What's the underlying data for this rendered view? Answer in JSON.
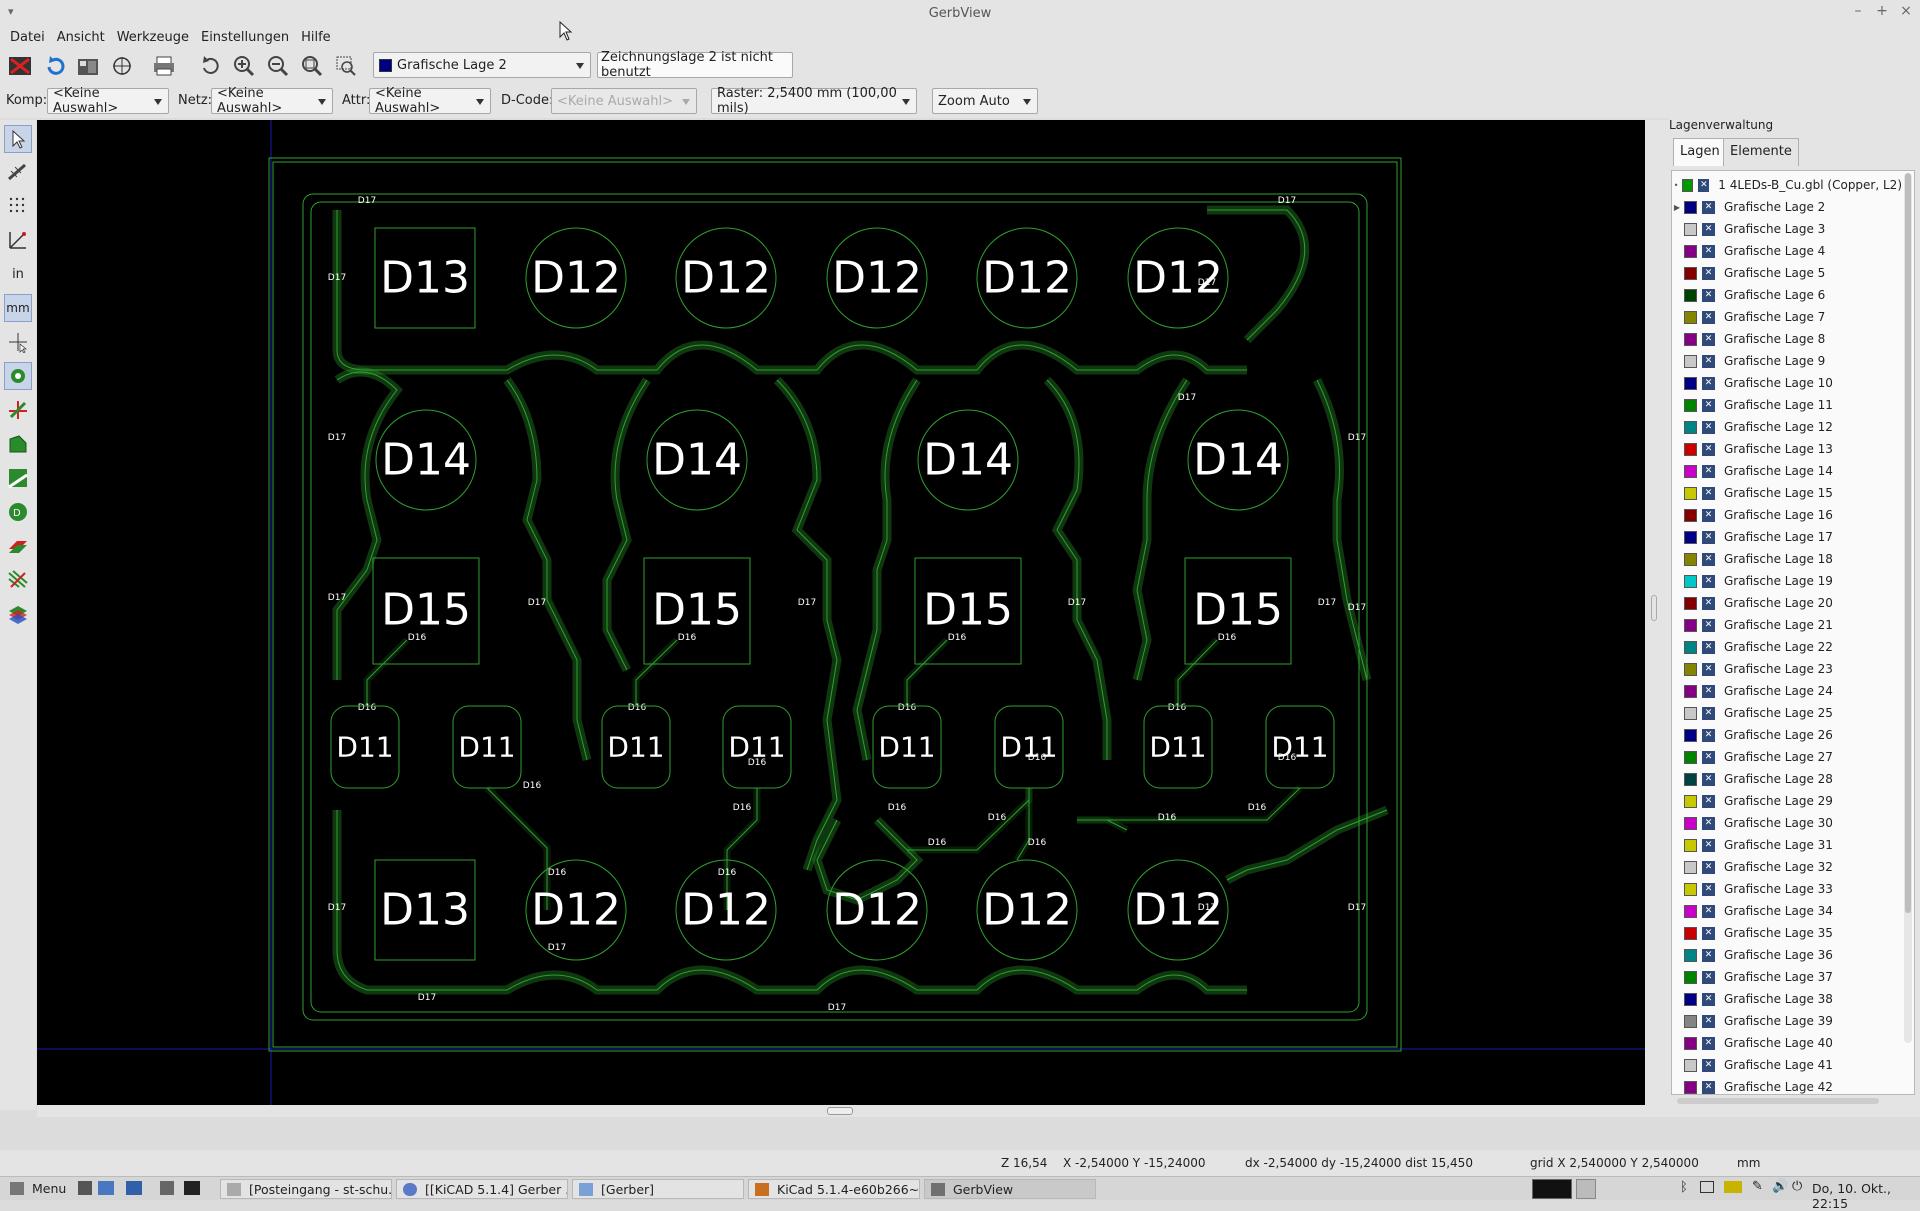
{
  "window": {
    "title": "GerbView"
  },
  "menu": [
    "Datei",
    "Ansicht",
    "Werkzeuge",
    "Einstellungen",
    "Hilfe"
  ],
  "toolbar": {
    "layer_select": {
      "value": "Grafische Lage 2",
      "color": "#000080"
    },
    "dcode_notice": "Zeichnungslage 2 ist nicht benutzt"
  },
  "filterbar": {
    "komp_label": "Komp:",
    "komp_value": "<Keine Auswahl>",
    "netz_label": "Netz:",
    "netz_value": "<Keine Auswahl>",
    "attr_label": "Attr:",
    "attr_value": "<Keine Auswahl>",
    "dcode_label": "D-Code:",
    "dcode_value": "<Keine Auswahl>",
    "grid_value": "Raster: 2,5400 mm (100,00 mils)",
    "zoom_value": "Zoom Auto"
  },
  "left_toolbar": {
    "units_in": "in",
    "units_mm": "mm"
  },
  "canvas": {
    "pad_labels": {
      "top_row": [
        "D13",
        "D12",
        "D12",
        "D12",
        "D12",
        "D12"
      ],
      "row_d14": [
        "D14",
        "D14",
        "D14",
        "D14"
      ],
      "row_d15": [
        "D15",
        "D15",
        "D15",
        "D15"
      ],
      "row_d11": [
        "D11",
        "D11",
        "D11",
        "D11",
        "D11",
        "D11",
        "D11",
        "D11"
      ],
      "bottom_row": [
        "D13",
        "D12",
        "D12",
        "D12",
        "D12",
        "D12"
      ]
    },
    "trace_labels": {
      "d16": "D16",
      "d17": "D17"
    },
    "colors": {
      "background": "#000000",
      "outline": "#2fa12f",
      "axis": "#0000aa"
    }
  },
  "panel": {
    "title": "Lagenverwaltung",
    "tabs": [
      "Lagen",
      "Elemente"
    ],
    "layers": [
      {
        "name": "1 4LEDs-B_Cu.gbl (Copper, L2)",
        "color": "#009900"
      },
      {
        "name": "Grafische Lage 2",
        "color": "#000080"
      },
      {
        "name": "Grafische Lage 3",
        "color": "#c8c8c8"
      },
      {
        "name": "Grafische Lage 4",
        "color": "#840084"
      },
      {
        "name": "Grafische Lage 5",
        "color": "#840000"
      },
      {
        "name": "Grafische Lage 6",
        "color": "#004200"
      },
      {
        "name": "Grafische Lage 7",
        "color": "#848400"
      },
      {
        "name": "Grafische Lage 8",
        "color": "#840084"
      },
      {
        "name": "Grafische Lage 9",
        "color": "#c8c8c8"
      },
      {
        "name": "Grafische Lage 10",
        "color": "#000084"
      },
      {
        "name": "Grafische Lage 11",
        "color": "#008400"
      },
      {
        "name": "Grafische Lage 12",
        "color": "#008484"
      },
      {
        "name": "Grafische Lage 13",
        "color": "#c80000"
      },
      {
        "name": "Grafische Lage 14",
        "color": "#c800c8"
      },
      {
        "name": "Grafische Lage 15",
        "color": "#c8c800"
      },
      {
        "name": "Grafische Lage 16",
        "color": "#840000"
      },
      {
        "name": "Grafische Lage 17",
        "color": "#000084"
      },
      {
        "name": "Grafische Lage 18",
        "color": "#848400"
      },
      {
        "name": "Grafische Lage 19",
        "color": "#00c8c8"
      },
      {
        "name": "Grafische Lage 20",
        "color": "#840000"
      },
      {
        "name": "Grafische Lage 21",
        "color": "#840084"
      },
      {
        "name": "Grafische Lage 22",
        "color": "#008484"
      },
      {
        "name": "Grafische Lage 23",
        "color": "#848400"
      },
      {
        "name": "Grafische Lage 24",
        "color": "#840084"
      },
      {
        "name": "Grafische Lage 25",
        "color": "#c8c8c8"
      },
      {
        "name": "Grafische Lage 26",
        "color": "#000084"
      },
      {
        "name": "Grafische Lage 27",
        "color": "#008400"
      },
      {
        "name": "Grafische Lage 28",
        "color": "#004242"
      },
      {
        "name": "Grafische Lage 29",
        "color": "#c8c800"
      },
      {
        "name": "Grafische Lage 30",
        "color": "#c800c8"
      },
      {
        "name": "Grafische Lage 31",
        "color": "#c8c800"
      },
      {
        "name": "Grafische Lage 32",
        "color": "#c8c8c8"
      },
      {
        "name": "Grafische Lage 33",
        "color": "#c8c800"
      },
      {
        "name": "Grafische Lage 34",
        "color": "#c800c8"
      },
      {
        "name": "Grafische Lage 35",
        "color": "#c80000"
      },
      {
        "name": "Grafische Lage 36",
        "color": "#008484"
      },
      {
        "name": "Grafische Lage 37",
        "color": "#008400"
      },
      {
        "name": "Grafische Lage 38",
        "color": "#000084"
      },
      {
        "name": "Grafische Lage 39",
        "color": "#848484"
      },
      {
        "name": "Grafische Lage 40",
        "color": "#840084"
      },
      {
        "name": "Grafische Lage 41",
        "color": "#c8c8c8"
      },
      {
        "name": "Grafische Lage 42",
        "color": "#840084"
      }
    ]
  },
  "status": {
    "zoom": "Z 16,54",
    "xy": "X -2,54000  Y -15,24000",
    "delta": "dx -2,54000  dy -15,24000  dist 15,450",
    "grid": "grid X 2,540000  Y 2,540000",
    "units": "mm"
  },
  "taskbar": {
    "menu": "Menu",
    "tasks": [
      "[Posteingang - st-schu...",
      "[[KiCAD 5.1.4] Gerber ...",
      "[Gerber]",
      "KiCad 5.1.4-e60b266~...",
      "GerbView"
    ],
    "clock": "Do, 10. Okt., 22:15"
  }
}
